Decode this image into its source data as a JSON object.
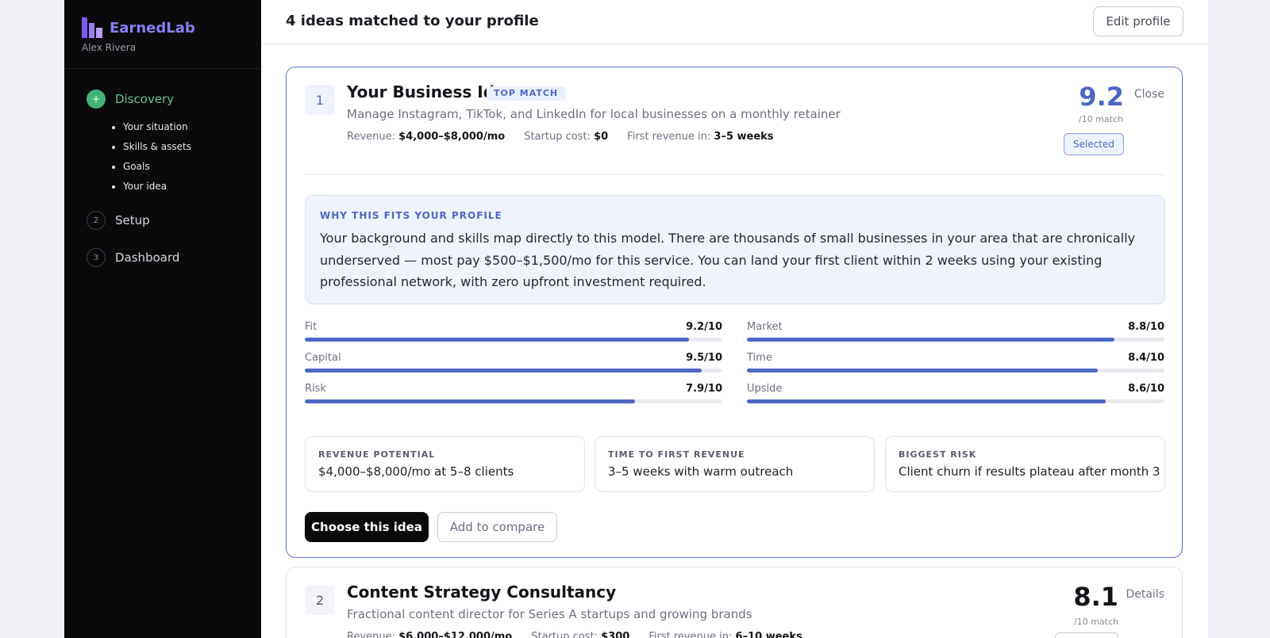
{
  "sidebar": {
    "brand": "EarnedLab",
    "user": "Alex Rivera",
    "steps": [
      {
        "num": "+",
        "label": "Discovery"
      },
      {
        "num": "2",
        "label": "Setup"
      },
      {
        "num": "3",
        "label": "Dashboard"
      }
    ],
    "substeps": [
      "Your situation",
      "Skills & assets",
      "Goals",
      "Your idea"
    ]
  },
  "header": {
    "title": "4 ideas matched to your profile",
    "edit_label": "Edit profile"
  },
  "idea1": {
    "rank": "1",
    "title": "Your Business Idea",
    "badge": "TOP MATCH",
    "subtitle": "Manage Instagram, TikTok, and LinkedIn for local businesses on a monthly retainer",
    "revenue_label": "Revenue:",
    "revenue": "$4,000–$8,000/mo",
    "startup_label": "Startup cost:",
    "startup": "$0",
    "first_label": "First revenue in:",
    "first": "3–5 weeks",
    "score": "9.2",
    "score_sub": "/10 match",
    "close_label": "Close",
    "selected_label": "Selected",
    "why_title": "WHY THIS FITS YOUR PROFILE",
    "why_text": "Your background and skills map directly to this model. There are thousands of small businesses in your area that are chronically underserved — most pay $500–$1,500/mo for this service. You can land your first client within 2 weeks using your existing professional network, with zero upfront investment required.",
    "metrics": [
      {
        "label": "Fit",
        "value": "9.2/10",
        "score": 9.2
      },
      {
        "label": "Market",
        "value": "8.8/10",
        "score": 8.8
      },
      {
        "label": "Capital",
        "value": "9.5/10",
        "score": 9.5
      },
      {
        "label": "Time",
        "value": "8.4/10",
        "score": 8.4
      },
      {
        "label": "Risk",
        "value": "7.9/10",
        "score": 7.9
      },
      {
        "label": "Upside",
        "value": "8.6/10",
        "score": 8.6
      }
    ],
    "boxes": [
      {
        "label": "REVENUE POTENTIAL",
        "value": "$4,000–$8,000/mo at 5–8 clients"
      },
      {
        "label": "TIME TO FIRST REVENUE",
        "value": "3–5 weeks with warm outreach"
      },
      {
        "label": "BIGGEST RISK",
        "value": "Client churn if results plateau after month 3"
      }
    ],
    "choose_label": "Choose this idea",
    "compare_label": "Add to compare"
  },
  "idea2": {
    "rank": "2",
    "title": "Content Strategy Consultancy",
    "subtitle": "Fractional content director for Series A startups and growing brands",
    "revenue_label": "Revenue:",
    "revenue": "$6,000–$12,000/mo",
    "startup_label": "Startup cost:",
    "startup": "$300",
    "first_label": "First revenue in:",
    "first": "6–10 weeks",
    "score": "8.1",
    "score_sub": "/10 match",
    "details_label": "Details"
  }
}
